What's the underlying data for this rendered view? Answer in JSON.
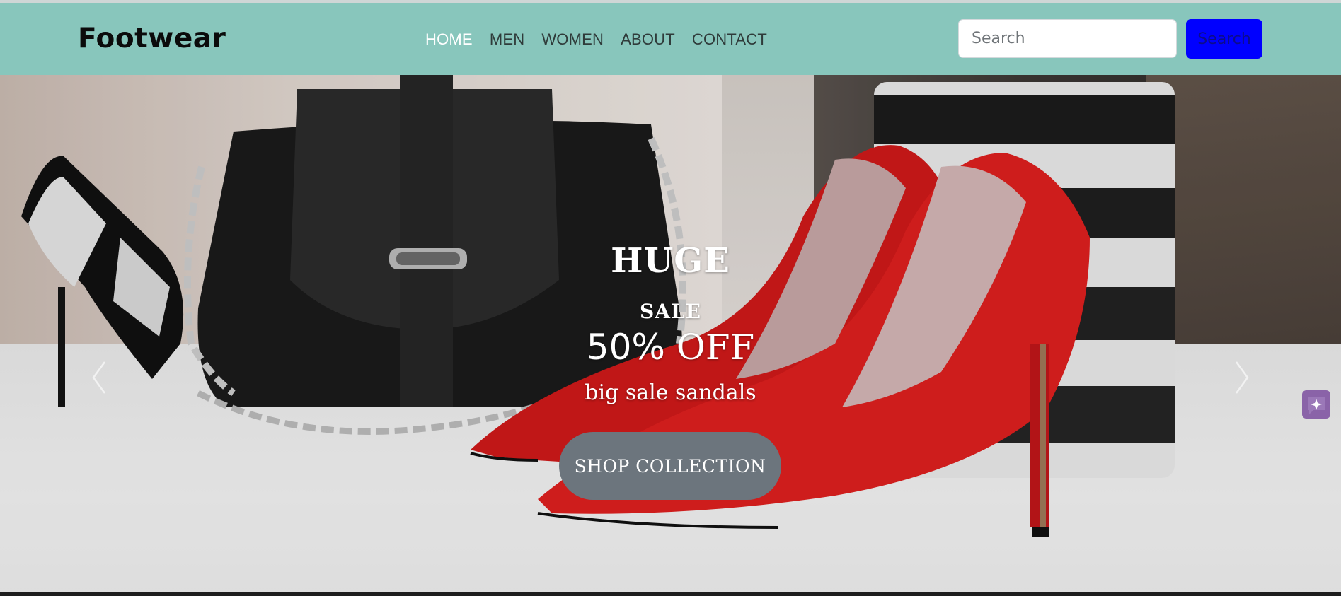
{
  "brand": "Footwear",
  "nav": {
    "items": [
      {
        "label": "HOME",
        "active": true
      },
      {
        "label": "MEN",
        "active": false
      },
      {
        "label": "WOMEN",
        "active": false
      },
      {
        "label": "ABOUT",
        "active": false
      },
      {
        "label": "CONTACT",
        "active": false
      }
    ]
  },
  "search": {
    "placeholder": "Search",
    "button_label": "Search"
  },
  "hero": {
    "line1": "HUGE",
    "line2": "SALE",
    "percent": "50%",
    "off": "OFF",
    "subtitle": "big sale sandals",
    "cta_label": "SHOP COLLECTION"
  },
  "icons": {
    "prev": "chevron-left-icon",
    "next": "chevron-right-icon",
    "chat": "sparkle-chat-icon"
  },
  "colors": {
    "navbar_bg": "#88c6bc",
    "search_button_bg": "#0000ff",
    "cta_bg": "#6c757d",
    "chat_bg": "#8a63a8"
  }
}
